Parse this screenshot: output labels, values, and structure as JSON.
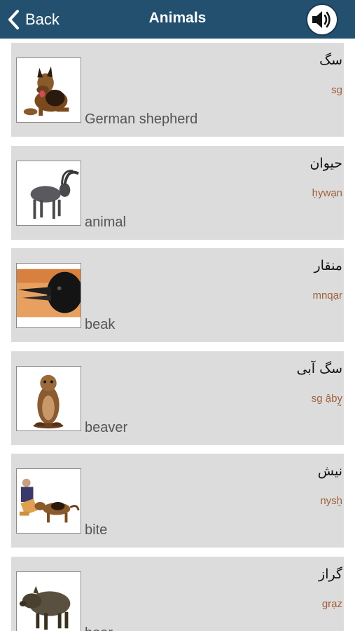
{
  "header": {
    "back_label": "Back",
    "title": "Animals",
    "speaker_icon": "speaker-icon",
    "bar_color": "#23506e"
  },
  "items": [
    {
      "english": "German shepherd",
      "native": "سگ",
      "translit": "sg",
      "image": "german-shepherd-image"
    },
    {
      "english": "animal",
      "native": "حیوان",
      "translit": "ḥywạn",
      "image": "ibex-image"
    },
    {
      "english": "beak",
      "native": "منقار",
      "translit": "mnqạr",
      "image": "crow-beak-image"
    },
    {
      "english": "beaver",
      "native": "سگ آبی",
      "translit": "sg ậby̰",
      "image": "beaver-image"
    },
    {
      "english": "bite",
      "native": "نیش",
      "translit": "nysẖ",
      "image": "dog-bite-image"
    },
    {
      "english": "boar",
      "native": "گراز",
      "translit": "grạz",
      "image": "boar-image"
    }
  ],
  "colors": {
    "card_bg": "#dcdcdc",
    "english_text": "#555555",
    "translit_text": "#a0603a"
  }
}
